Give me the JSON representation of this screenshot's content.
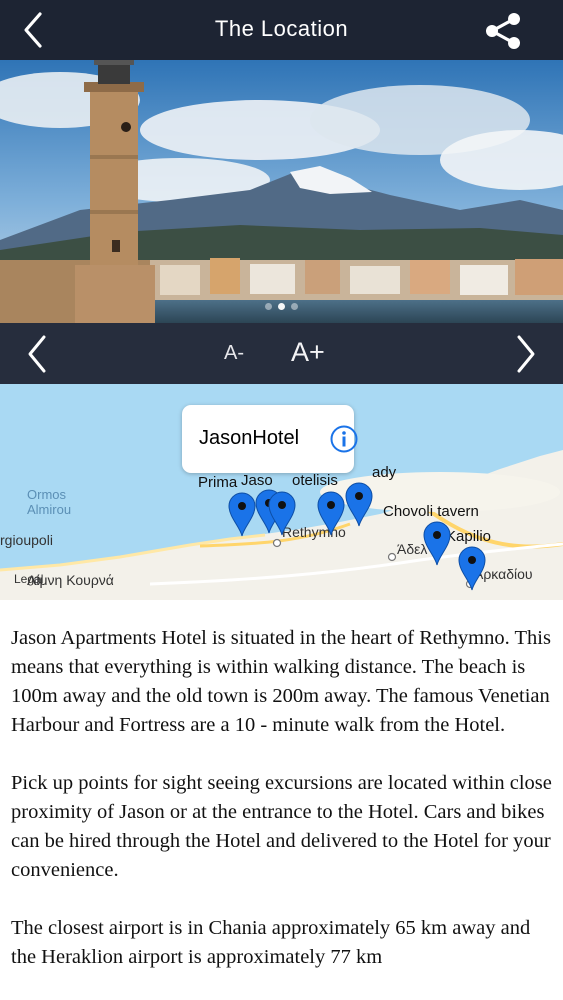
{
  "header": {
    "title": "The Location",
    "back_icon": "chevron-left-icon",
    "share_icon": "share-icon"
  },
  "hero": {
    "slide_count": 3,
    "active_slide": 2
  },
  "controls": {
    "decrease_font_label": "A-",
    "increase_font_label": "A+",
    "prev_icon": "chevron-left-icon",
    "next_icon": "chevron-right-icon"
  },
  "map": {
    "callout": {
      "name": "JasonHotel",
      "info_icon": "info-icon"
    },
    "sea_label": [
      "Ormos",
      "Almirou"
    ],
    "labels": {
      "georgioupoli": "rgioupoli",
      "rethymno": "Rethymno",
      "kourna": "Λίμνη Κουρνά",
      "legal": "Legal",
      "adele": "Άδελ",
      "arkadiou": "Αρκαδίου",
      "prima": "Prima",
      "jaso": "Jaso",
      "hotelisis": "otelisis",
      "lady": "ady",
      "chovoli": "Chovoli tavern",
      "kapilio": "Kapilio"
    },
    "pin_color": "#1a73e8"
  },
  "description": {
    "paragraphs": [
      "Jason Apartments Hotel is situated in the heart of Rethymno. This means that everything is within walking distance. The beach is 100m away and the old town is 200m away. The famous Venetian Harbour and Fortress are a 10 - minute walk from the Hotel.",
      "Pick up points for sight seeing excursions are located within close proximity of Jason or at the entrance to the Hotel. Cars and bikes can be hired through the Hotel and delivered to the Hotel for your convenience.",
      "The closest airport is in Chania approximately 65 km away and the Heraklion airport is approximately 77 km"
    ]
  },
  "colors": {
    "header_bg": "#1d2433",
    "controls_bg": "#262d3d",
    "sea": "#a9d9f3",
    "land": "#f3f1ea"
  }
}
